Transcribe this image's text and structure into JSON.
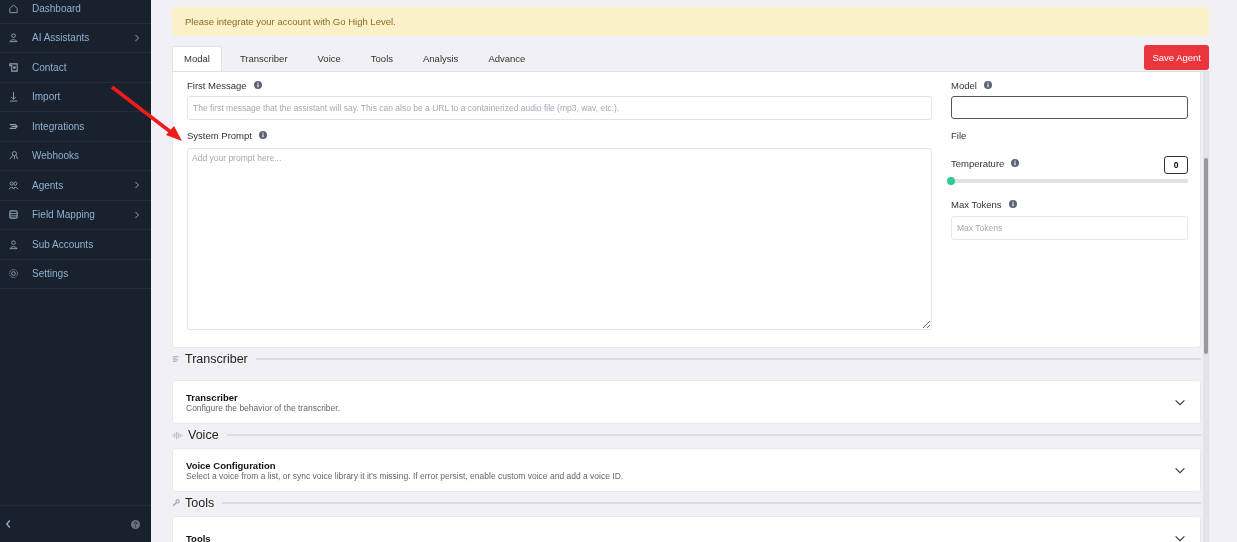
{
  "sidebar": {
    "items": [
      {
        "label": "Dashboard",
        "kind": "home",
        "has_submenu": false
      },
      {
        "label": "AI Assistants",
        "kind": "user",
        "has_submenu": true
      },
      {
        "label": "Contact",
        "kind": "contact",
        "has_submenu": false
      },
      {
        "label": "Import",
        "kind": "import",
        "has_submenu": false
      },
      {
        "label": "Integrations",
        "kind": "plug",
        "has_submenu": false
      },
      {
        "label": "Webhooks",
        "kind": "hook",
        "has_submenu": false
      },
      {
        "label": "Agents",
        "kind": "users",
        "has_submenu": true
      },
      {
        "label": "Field Mapping",
        "kind": "database",
        "has_submenu": true
      },
      {
        "label": "Sub Accounts",
        "kind": "user",
        "has_submenu": false
      },
      {
        "label": "Settings",
        "kind": "gear",
        "has_submenu": false
      }
    ]
  },
  "alert": {
    "text": "Please integrate your account with Go High Level."
  },
  "tabs": [
    {
      "label": "Modal",
      "selected": true
    },
    {
      "label": "Transcriber",
      "selected": false
    },
    {
      "label": "Voice",
      "selected": false
    },
    {
      "label": "Tools",
      "selected": false
    },
    {
      "label": "Analysis",
      "selected": false
    },
    {
      "label": "Advance",
      "selected": false
    }
  ],
  "save_button": "Save Agent",
  "form": {
    "first_message": {
      "label": "First Message",
      "placeholder": "The first message that the assistant will say. This can also be a URL to a containerized audio file (mp3, wav, etc.)."
    },
    "system_prompt": {
      "label": "System Prompt",
      "placeholder": "Add your prompt here..."
    },
    "model": {
      "label": "Model"
    },
    "file": {
      "label": "File"
    },
    "temperature": {
      "label": "Temperature",
      "level": 0,
      "reading": "0"
    },
    "max_tokens": {
      "label": "Max Tokens",
      "placeholder": "Max Tokens"
    }
  },
  "sections": [
    {
      "heading": "Transcriber",
      "kind": "lines",
      "card": {
        "title": "Transcriber",
        "description": "Configure the behavior of the transcriber."
      }
    },
    {
      "heading": "Voice",
      "kind": "wave",
      "card": {
        "title": "Voice Configuration",
        "description": "Select a voice from a list, or sync voice library it it's missing. If error persist, enable custom voice and add a voice ID."
      }
    },
    {
      "heading": "Tools",
      "kind": "wrench",
      "card": {
        "title": "Tools"
      }
    }
  ]
}
